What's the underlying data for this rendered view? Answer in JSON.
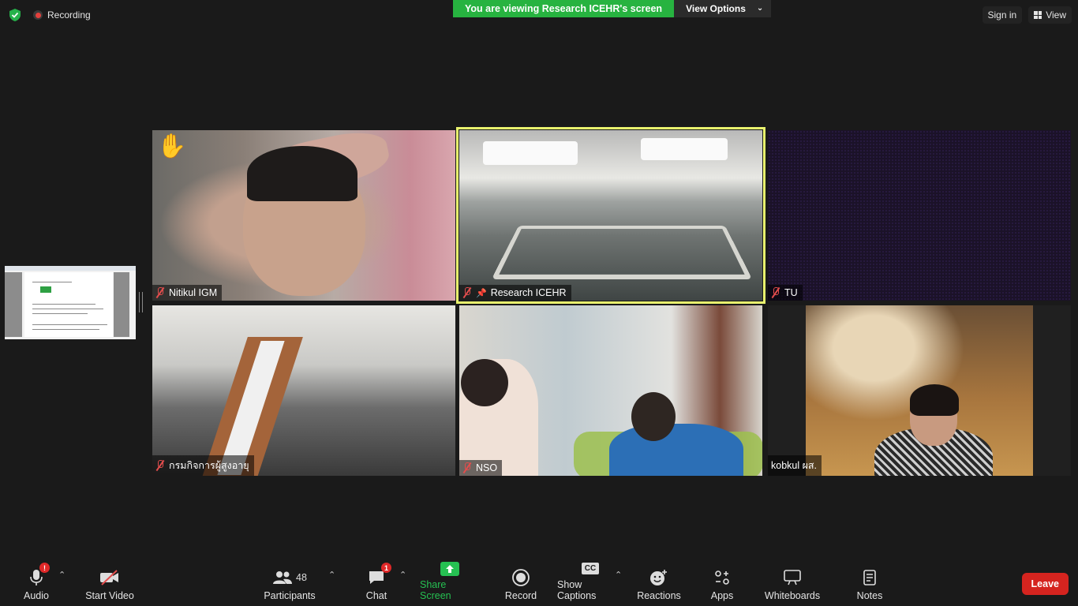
{
  "top": {
    "recording_label": "Recording",
    "viewing_banner": "You are viewing Research ICEHR's screen",
    "view_options": "View Options",
    "sign_in": "Sign in",
    "view": "View"
  },
  "tiles": [
    {
      "name": "Nitikul IGM",
      "muted": true,
      "hand_raised": true
    },
    {
      "name": "Research ICEHR",
      "muted": true,
      "pinned": true,
      "active_speaker": true
    },
    {
      "name": "TU",
      "muted": true
    },
    {
      "name": "กรมกิจการผู้สูงอายุ",
      "muted": true
    },
    {
      "name": "NSO",
      "muted": true
    },
    {
      "name": "kobkul ผส.",
      "muted": false
    }
  ],
  "toolbar": {
    "audio": "Audio",
    "audio_badge": "!",
    "start_video": "Start Video",
    "participants": "Participants",
    "participants_count": "48",
    "chat": "Chat",
    "chat_badge": "1",
    "share_screen": "Share Screen",
    "record": "Record",
    "show_captions": "Show Captions",
    "captions_icon_text": "CC",
    "reactions": "Reactions",
    "apps": "Apps",
    "whiteboards": "Whiteboards",
    "notes": "Notes",
    "leave": "Leave"
  },
  "colors": {
    "banner_green": "#27b340",
    "share_green": "#26c052",
    "leave_red": "#d5241f",
    "active_border": "#e9f36e",
    "muted_red": "#e34d4d"
  }
}
